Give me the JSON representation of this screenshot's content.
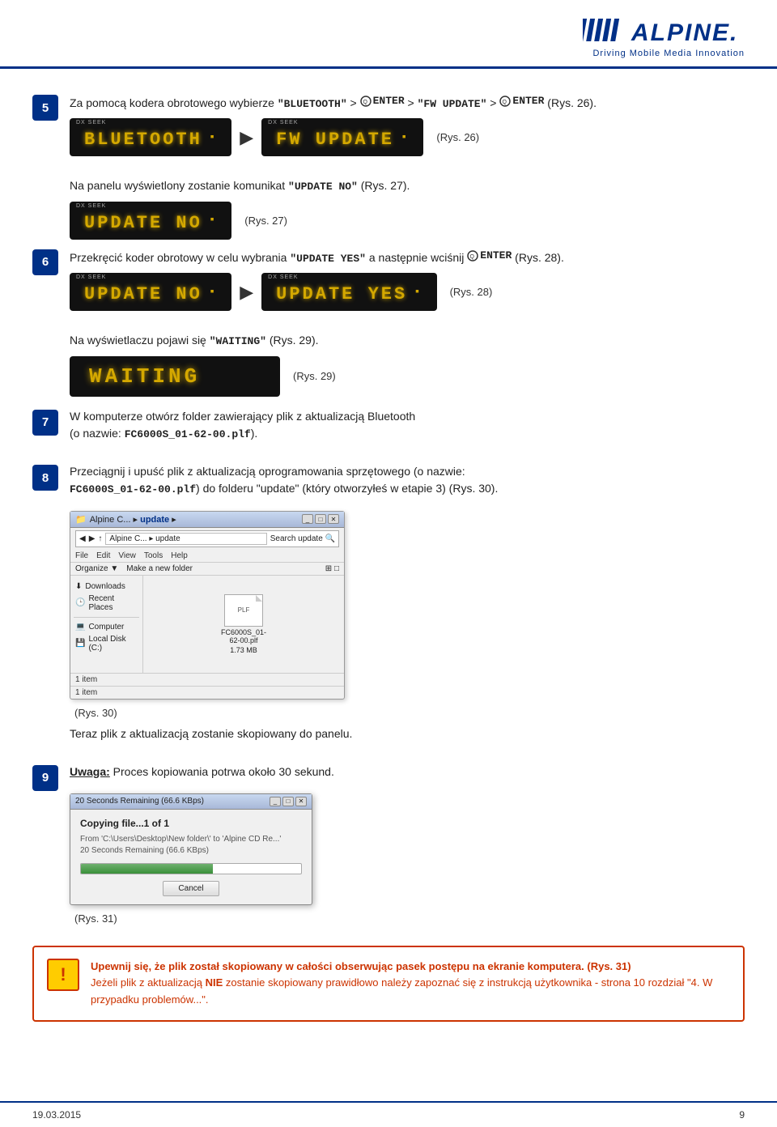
{
  "header": {
    "logo_text": "////ALPINE.",
    "tagline": "Driving Mobile Media Innovation"
  },
  "footer": {
    "date": "19.03.2015",
    "page": "9"
  },
  "steps": [
    {
      "num": "5",
      "text": "Za pomocą kodera obrotowego wybierze \"BLUETOOTH\" > ENTER > \"FW UPDATE\" > ENTER (Rys. 26).",
      "rys_label": "(Rys. 26)",
      "screen1_label": "DX SEEK",
      "screen1_text": "BLUETOOTH",
      "screen2_label": "DX SEEK",
      "screen2_text": "FW UPDATE"
    },
    {
      "num": "",
      "text": "Na panelu wyświetlony zostanie komunikat \"UPDATE NO\" (Rys. 27).",
      "rys27": "(Rys. 27)",
      "screen_text": "UPDATE NO"
    },
    {
      "num": "6",
      "text": "Przekręcić koder obrotowy w celu wybrania \"UPDATE YES\" a następnie wciśnij ENTER (Rys. 28).",
      "rys28": "(Rys. 28)",
      "screen1_text": "UPDATE NO",
      "screen2_text": "UPDATE YES"
    },
    {
      "num": "",
      "text_before": "Na wyświetlaczu pojawi się \"WAITING\" (Rys. 29).",
      "rys29": "(Rys. 29)",
      "waiting_text": "WAITING"
    },
    {
      "num": "7",
      "text": "W komputerze otwórz folder zawierający plik z aktualizacją Bluetooth (o nazwie: FC6000S_01-62-00.plf)."
    },
    {
      "num": "8",
      "text": "Przeciągnij i upuść plik z aktualizacją oprogramowania sprzętowego (o nazwie: FC6000S_01-62-00.plf) do folderu \"update\" (który otworzyłeś w etapie 3) (Rys. 30).",
      "rys30": "(Rys. 30)",
      "fe": {
        "title": "update",
        "address": "Alpine C... > update",
        "search_placeholder": "Search update",
        "menu": [
          "File",
          "Edit",
          "View",
          "Tools",
          "Help"
        ],
        "toolbar": [
          "Organize ▼",
          "Make a new folder"
        ],
        "sidebar": [
          "Downloads",
          "Recent Places",
          "Computer",
          "Local Disk (C:)"
        ],
        "file_name": "FC6000S_01-62-00.plf",
        "file_size": "1.73 MB",
        "status": "1 item"
      },
      "note": "Teraz plik z aktualizacją zostanie skopiowany do panelu."
    },
    {
      "num": "9",
      "uwaga_label": "Uwaga:",
      "uwaga_text": "Proces kopiowania potrwa około 30 sekund.",
      "dialog": {
        "title_bar": "20 Seconds Remaining (66.6 KBps)",
        "heading": "Copying file...1 of 1",
        "from": "From 'C:\\Users\\Desktop\\New folder\\' to 'Alpine CD Re...'",
        "remaining": "20 Seconds Remaining (66.6 KBps)",
        "cancel": "Cancel"
      },
      "rys31": "(Rys. 31)"
    }
  ],
  "warning": {
    "line1": "Upewnij się, że plik został skopiowany w całości obserwując pasek postępu na ekranie komputera. (Rys. 31)",
    "line2": "Jeżeli plik z aktualizacją NIE zostanie skopiowany prawidłowo należy zapoznać się z instrukcją użytkownika - strona 10 rozdział \"4. W przypadku problemów...\"."
  }
}
